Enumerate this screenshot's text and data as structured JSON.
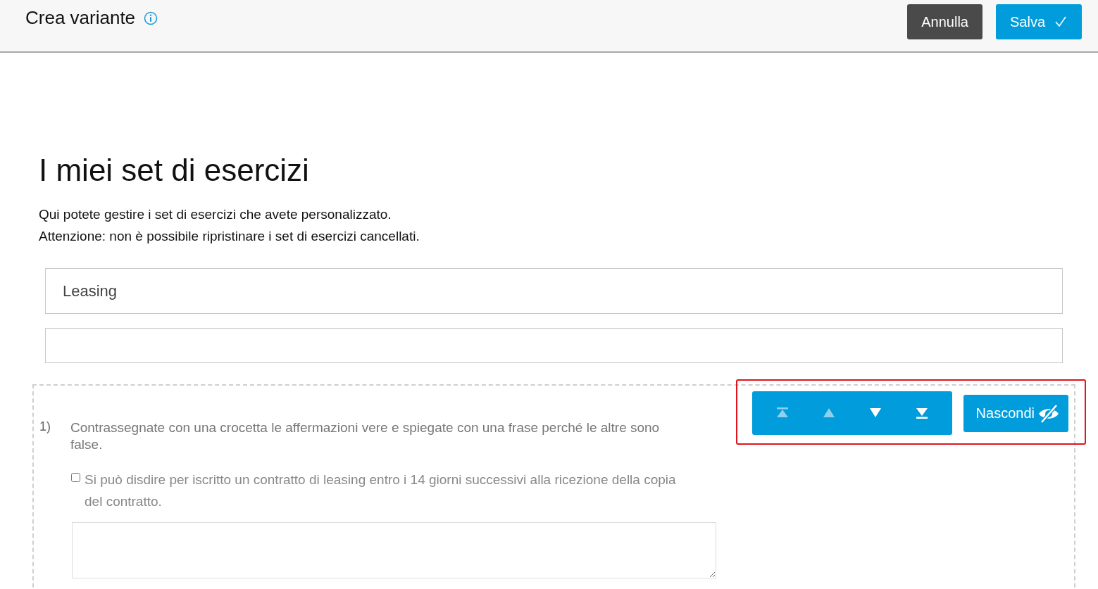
{
  "header": {
    "title": "Crea variante",
    "buttons": [
      {
        "kind": "cancel",
        "label": "Annulla"
      },
      {
        "kind": "save",
        "label": "Salva"
      }
    ]
  },
  "page": {
    "heading": "I miei set di esercizi",
    "intro": [
      "Qui potete gestire i set di esercizi che avete personalizzato.",
      "Attenzione: non è possibile ripristinare i set di esercizi cancellati."
    ]
  },
  "fields": [
    {
      "kind": "title",
      "value": "Leasing"
    },
    {
      "kind": "description"
    }
  ],
  "exercise": {
    "number": "1)",
    "prompt": "Contrassegnate con una crocetta le affermazioni vere e spiegate con una frase perché le altre sono false.",
    "statements": [
      {
        "text": "Si può disdire per iscritto un contratto di leasing entro i 14 giorni successivi alla ricezione della copia del contratto.",
        "checked": false
      }
    ],
    "toolbar": {
      "highlighted": true,
      "moves": [
        {
          "kind": "top",
          "disabled": true
        },
        {
          "kind": "up",
          "disabled": true
        },
        {
          "kind": "down",
          "disabled": false
        },
        {
          "kind": "bottom",
          "disabled": false
        }
      ],
      "hide_label": "Nascondi"
    }
  }
}
